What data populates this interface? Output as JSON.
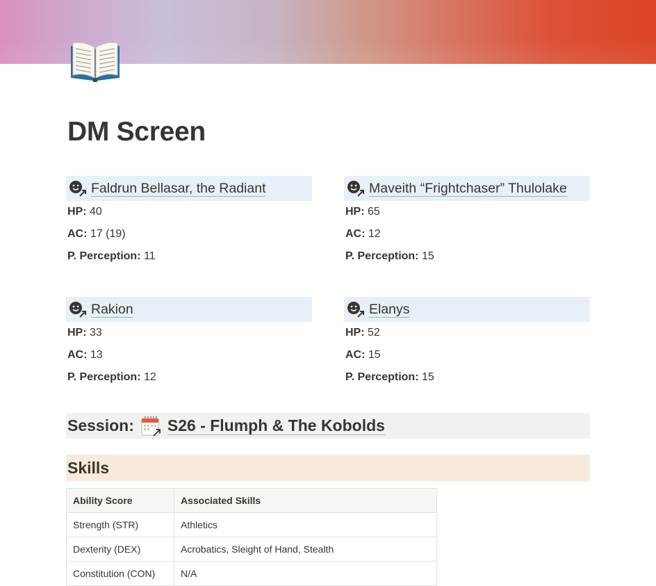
{
  "page": {
    "title": "DM Screen",
    "icon": "open-book-icon"
  },
  "characters": [
    {
      "name": "Faldrun Bellasar, the Radiant",
      "icon": "face-link-icon",
      "hp_label": "HP:",
      "hp": "40",
      "ac_label": "AC:",
      "ac": "17 (19)",
      "perception_label": "P. Perception:",
      "perception": "11"
    },
    {
      "name": "Maveith “Frightchaser” Thulolake",
      "icon": "face-link-icon",
      "hp_label": "HP:",
      "hp": "65",
      "ac_label": "AC:",
      "ac": "12",
      "perception_label": "P. Perception:",
      "perception": "15"
    },
    {
      "name": "Rakion",
      "icon": "face-link-icon",
      "hp_label": "HP:",
      "hp": "33",
      "ac_label": "AC:",
      "ac": "13",
      "perception_label": "P. Perception:",
      "perception": "12"
    },
    {
      "name": "Elanys",
      "icon": "face-link-icon",
      "hp_label": "HP:",
      "hp": "52",
      "ac_label": "AC:",
      "ac": "15",
      "perception_label": "P. Perception:",
      "perception": "15"
    }
  ],
  "session": {
    "label": "Session:",
    "link": "S26 - Flumph & The Kobolds",
    "icon": "calendar-link-icon"
  },
  "skills": {
    "heading": "Skills",
    "columns": [
      "Ability Score",
      "Associated Skills"
    ],
    "rows": [
      [
        "Strength (STR)",
        "Athletics"
      ],
      [
        "Dexterity (DEX)",
        "Acrobatics, Sleight of Hand, Stealth"
      ],
      [
        "Constitution (CON)",
        "N/A"
      ]
    ]
  },
  "colors": {
    "character_header_bg": "#e7f0f6",
    "session_bg": "#f1f1ef",
    "skills_bg": "#f8ebdc",
    "cover_start": "#d98fc0",
    "cover_end": "#dc4424"
  }
}
